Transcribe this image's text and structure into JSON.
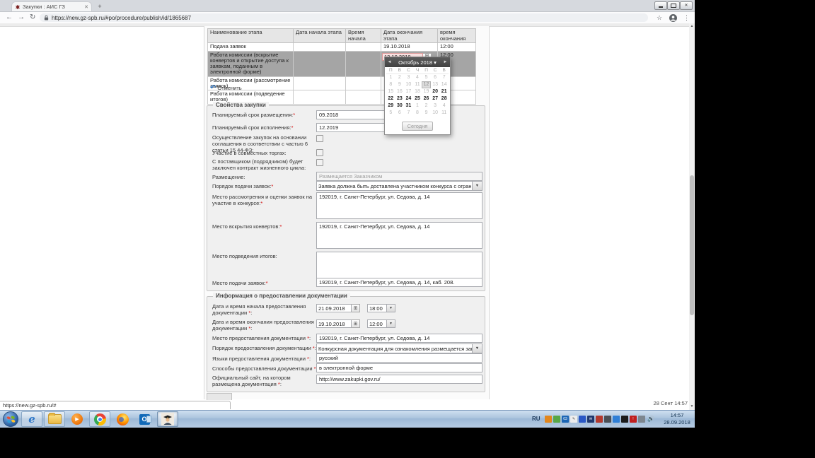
{
  "browser": {
    "tab_title": "Закупки : АИС ГЗ",
    "url": "https://new.gz-spb.ru/#po/procedure/publish/id/1865687",
    "icons": {
      "back": "←",
      "forward": "→",
      "reload": "↻",
      "star": "☆",
      "menu": "⋮",
      "new_tab": "+",
      "tab_close": "✕",
      "win_close": "✕",
      "dropdown_arrow": "▼",
      "calendar_button": "⊞"
    }
  },
  "status_bar": {
    "link": "https://new.gz-spb.ru/#"
  },
  "page": {
    "footer_time": "28 Сент 14:57",
    "stages_table": {
      "headers": [
        "Наименование этапа",
        "Дата начала этапа",
        "Время начала",
        "Дата окончания этапа",
        "время окончания"
      ],
      "rows": [
        {
          "name": "Подача заявок",
          "end_date": "19.10.2018",
          "end_time": "12:00"
        },
        {
          "name": "Работа комиссии (вскрытие конвертов и открытие доступа к заявкам, поданным в электронной форме)",
          "end_date_value": "12.10.2018",
          "end_time": "12:00"
        },
        {
          "name": "Работа комиссии (рассмотрение заявок)"
        },
        {
          "name": "Работа комиссии (подведение итогов)"
        }
      ],
      "cancel_label": "Отменить",
      "cancel_icon": "↶"
    },
    "calendar": {
      "month_label": "Октябрь 2018 ▾",
      "prev_icon": "◄",
      "next_icon": "►",
      "day_names": [
        "П",
        "В",
        "С",
        "Ч",
        "П",
        "С",
        "В"
      ],
      "selected_day": "12",
      "today_label": "Сегодня",
      "days": [
        {
          "d": "1",
          "s": "out"
        },
        {
          "d": "2",
          "s": "out"
        },
        {
          "d": "3",
          "s": "out"
        },
        {
          "d": "4",
          "s": "out"
        },
        {
          "d": "5",
          "s": "out"
        },
        {
          "d": "6",
          "s": "out"
        },
        {
          "d": "7",
          "s": "out"
        },
        {
          "d": "8",
          "s": "out"
        },
        {
          "d": "9",
          "s": "out"
        },
        {
          "d": "10",
          "s": "out"
        },
        {
          "d": "11",
          "s": "out"
        },
        {
          "d": "12",
          "s": "sel"
        },
        {
          "d": "13",
          "s": "out"
        },
        {
          "d": "14",
          "s": "out"
        },
        {
          "d": "15",
          "s": "out"
        },
        {
          "d": "16",
          "s": "out"
        },
        {
          "d": "17",
          "s": "out"
        },
        {
          "d": "18",
          "s": "out"
        },
        {
          "d": "19",
          "s": "out"
        },
        {
          "d": "20",
          "s": "on"
        },
        {
          "d": "21",
          "s": "on"
        },
        {
          "d": "22",
          "s": "on"
        },
        {
          "d": "23",
          "s": "on"
        },
        {
          "d": "24",
          "s": "on"
        },
        {
          "d": "25",
          "s": "on"
        },
        {
          "d": "26",
          "s": "on"
        },
        {
          "d": "27",
          "s": "on"
        },
        {
          "d": "28",
          "s": "on"
        },
        {
          "d": "29",
          "s": "on"
        },
        {
          "d": "30",
          "s": "on"
        },
        {
          "d": "31",
          "s": "on"
        },
        {
          "d": "1",
          "s": "out"
        },
        {
          "d": "2",
          "s": "out"
        },
        {
          "d": "3",
          "s": "out"
        },
        {
          "d": "4",
          "s": "out"
        },
        {
          "d": "5",
          "s": "out"
        },
        {
          "d": "6",
          "s": "out"
        },
        {
          "d": "7",
          "s": "out"
        },
        {
          "d": "8",
          "s": "out"
        },
        {
          "d": "9",
          "s": "out"
        },
        {
          "d": "10",
          "s": "out"
        },
        {
          "d": "11",
          "s": "out"
        }
      ]
    },
    "properties": {
      "legend": "Свойства закупки",
      "placement_period": {
        "label": "Планируемый срок размещения:",
        "req": "*",
        "value": "09.2018"
      },
      "execution_period": {
        "label": "Планируемый срок исполнения:",
        "req": "*",
        "value": "12.2019"
      },
      "agreement_checkbox": {
        "label": "Осуществление закупок на основании соглашения в соответствии с частью 6 статьи 15 44-ФЗ:"
      },
      "joint_bidding_checkbox": {
        "label": "Участие в совместных торгах:"
      },
      "lifecycle_checkbox": {
        "label": "С поставщиком (подрядчиком) будет заключен контракт жизненного цикла:"
      },
      "placement": {
        "label": "Размещение:",
        "value": "Размещается Заказчиком"
      },
      "submission_order": {
        "label": "Порядок подачи заявок:",
        "req": "*",
        "value": "Заявка должна быть доставлена участником конкурса с ограниченным участи"
      },
      "review_place": {
        "label": "Место рассмотрения и оценки заявок на участие в конкурсе:",
        "req": "*",
        "value": "192019, г. Санкт-Петербург, ул. Седова, д. 14"
      },
      "opening_place": {
        "label": "Место вскрытия конвертов:",
        "req": "*",
        "value": "192019, г. Санкт-Петербург, ул. Седова, д. 14"
      },
      "results_place": {
        "label": "Место подведения итогов:",
        "value": ""
      },
      "submission_place": {
        "label": "Место подачи заявок:",
        "req": "*",
        "value": "192019, г. Санкт-Петербург, ул. Седова, д. 14, каб. 208."
      }
    },
    "documentation": {
      "legend": "Информация о предоставлении документации",
      "start_datetime": {
        "label": "Дата и время начала предоставления документации ",
        "req": "*",
        "tail": ":",
        "date": "21.09.2018",
        "time": "18:00"
      },
      "end_datetime": {
        "label": "Дата и время окончания предоставления документации ",
        "req": "*",
        "tail": ":",
        "date": "19.10.2018",
        "time": "12:00"
      },
      "place": {
        "label": "Место предоставления документации ",
        "req": "*",
        "tail": ":",
        "value": "192019, г. Санкт-Петербург, ул. Седова, д. 14"
      },
      "order": {
        "label": "Порядок предоставления документации ",
        "req": "*",
        "tail": ":",
        "value": "Конкурсная документация для ознакомления размещается заказчиком, уполн"
      },
      "languages": {
        "label": "Языки предоставления документации ",
        "req": "*",
        "tail": ":",
        "value": "русский"
      },
      "methods": {
        "label": "Способы предоставления документации ",
        "req": "*",
        "tail": ":",
        "value": "в электронной форме"
      },
      "site": {
        "label": "Официальный сайт, на котором размещена документация ",
        "req": "*",
        "tail": ":",
        "value": "http://www.zakupki.gov.ru/"
      }
    }
  },
  "taskbar": {
    "language": "RU",
    "clock_time": "14:57",
    "clock_date": "28.09.2018",
    "apps": [
      "start",
      "internet-explorer",
      "windows-explorer",
      "windows-media-player",
      "chrome",
      "firefox",
      "outlook",
      "ais-gz-client"
    ],
    "tray_icons": [
      {
        "c": "#e2861c",
        "g": ""
      },
      {
        "c": "#58a746",
        "g": ""
      },
      {
        "c": "#1c66b5",
        "g": "03"
      },
      {
        "c": "#ededed",
        "g": "✎",
        "tc": "#444"
      },
      {
        "c": "#2b58c5",
        "g": ""
      },
      {
        "c": "#20386e",
        "g": "✉"
      },
      {
        "c": "#b33a2e",
        "g": ""
      },
      {
        "c": "#4a4f55",
        "g": ""
      },
      {
        "c": "#2f7fd6",
        "g": ""
      },
      {
        "c": "#1b1b1b",
        "g": ""
      },
      {
        "c": "#c01f1f",
        "g": "!"
      },
      {
        "c": "#7d868f",
        "g": ""
      }
    ]
  }
}
